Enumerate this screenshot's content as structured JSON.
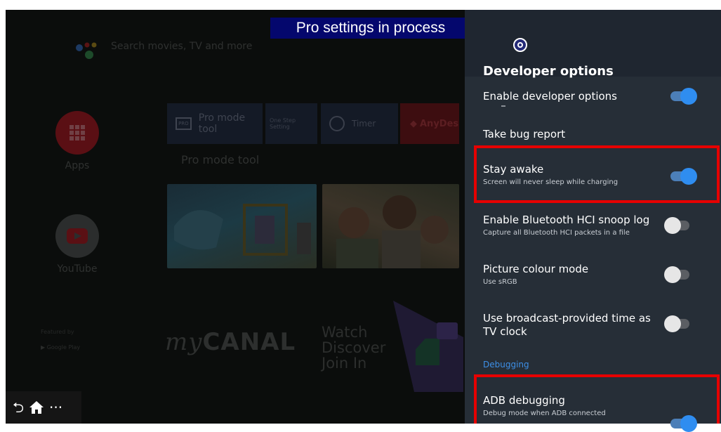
{
  "banner": {
    "text": "Pro settings in process"
  },
  "home": {
    "search_placeholder": "Search movies, TV and more",
    "apps_label": "Apps",
    "youtube_label": "YouTube",
    "tiles": {
      "pro_mode": "Pro mode tool",
      "pro_badge": "PRO",
      "one_step": "One Step Setting",
      "timer": "Timer",
      "anydesk": "AnyDes"
    },
    "row_label": "Pro mode tool",
    "featured": "Featured by",
    "google_play": "Google Play",
    "mycanal_my": "my",
    "mycanal_canal": "CANAL",
    "watch_lines": [
      "Watch",
      "Discover",
      "Join In"
    ]
  },
  "navbar": {
    "back_icon": "back-icon",
    "home_icon": "home-icon",
    "more": "···"
  },
  "panel": {
    "title": "Developer options",
    "settings": [
      {
        "title": "Enable developer options",
        "subtitle": "",
        "toggle": "on"
      },
      {
        "title": "Take bug report",
        "subtitle": ""
      },
      {
        "title": "Stay awake",
        "subtitle": "Screen will never sleep while charging",
        "toggle": "on"
      },
      {
        "title": "Enable Bluetooth HCI snoop log",
        "subtitle": "Capture all Bluetooth HCI packets in a file",
        "toggle": "off"
      },
      {
        "title": "Picture colour mode",
        "subtitle": "Use sRGB",
        "toggle": "off"
      },
      {
        "title": "Use broadcast-provided time as TV clock",
        "subtitle": "",
        "toggle": "off"
      }
    ],
    "section_debugging": "Debugging",
    "adb": {
      "title": "ADB debugging",
      "subtitle": "Debug mode when ADB connected",
      "toggle": "on"
    }
  },
  "colors": {
    "panel_bg": "#262e37",
    "toggle_on": "#2f8df0",
    "highlight": "#e60000",
    "banner_bg": "#04076d"
  }
}
